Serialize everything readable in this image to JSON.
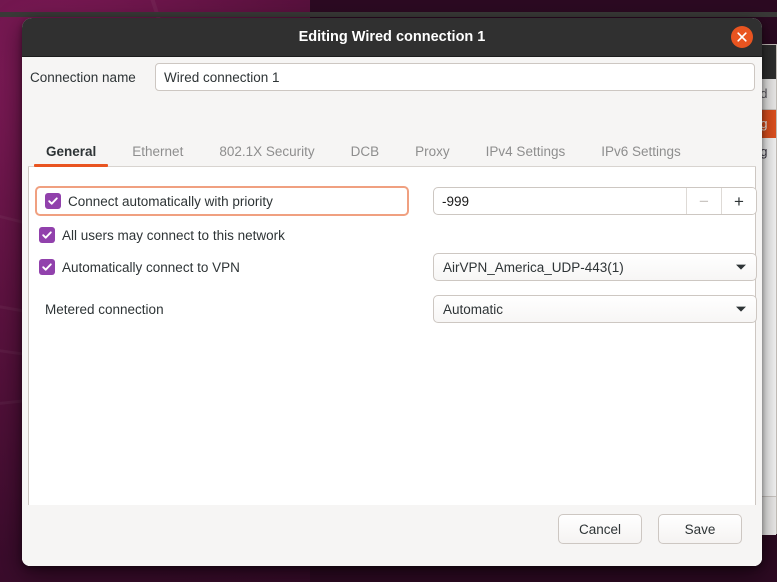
{
  "desktop": {
    "background_window": {
      "header_fragment": "ed",
      "selected_row_fragment": "ag",
      "row_fragment": "ag"
    }
  },
  "dialog": {
    "title": "Editing Wired connection 1",
    "close_icon": "close-icon",
    "connection_name": {
      "label": "Connection name",
      "value": "Wired connection 1",
      "placeholder": "Connection name"
    },
    "tabs": [
      {
        "label": "General",
        "active": true
      },
      {
        "label": "Ethernet",
        "active": false
      },
      {
        "label": "802.1X Security",
        "active": false
      },
      {
        "label": "DCB",
        "active": false
      },
      {
        "label": "Proxy",
        "active": false
      },
      {
        "label": "IPv4 Settings",
        "active": false
      },
      {
        "label": "IPv6 Settings",
        "active": false
      }
    ],
    "general": {
      "connect_automatically": {
        "label": "Connect automatically with priority",
        "checked": true,
        "focused": true,
        "priority_value": "-999",
        "minus_label": "−",
        "plus_label": "+",
        "minus_disabled": true
      },
      "all_users": {
        "label": "All users may connect to this network",
        "checked": true
      },
      "auto_vpn": {
        "label": "Automatically connect to VPN",
        "checked": true,
        "selected": "AirVPN_America_UDP-443(1)"
      },
      "metered": {
        "label": "Metered connection",
        "selected": "Automatic"
      }
    },
    "footer": {
      "cancel_label": "Cancel",
      "save_label": "Save"
    }
  },
  "colors": {
    "accent_orange": "#e95420",
    "checkbox_purple": "#9141ac",
    "titlebar_dark": "#303030",
    "focus_outline": "#f0a080"
  }
}
